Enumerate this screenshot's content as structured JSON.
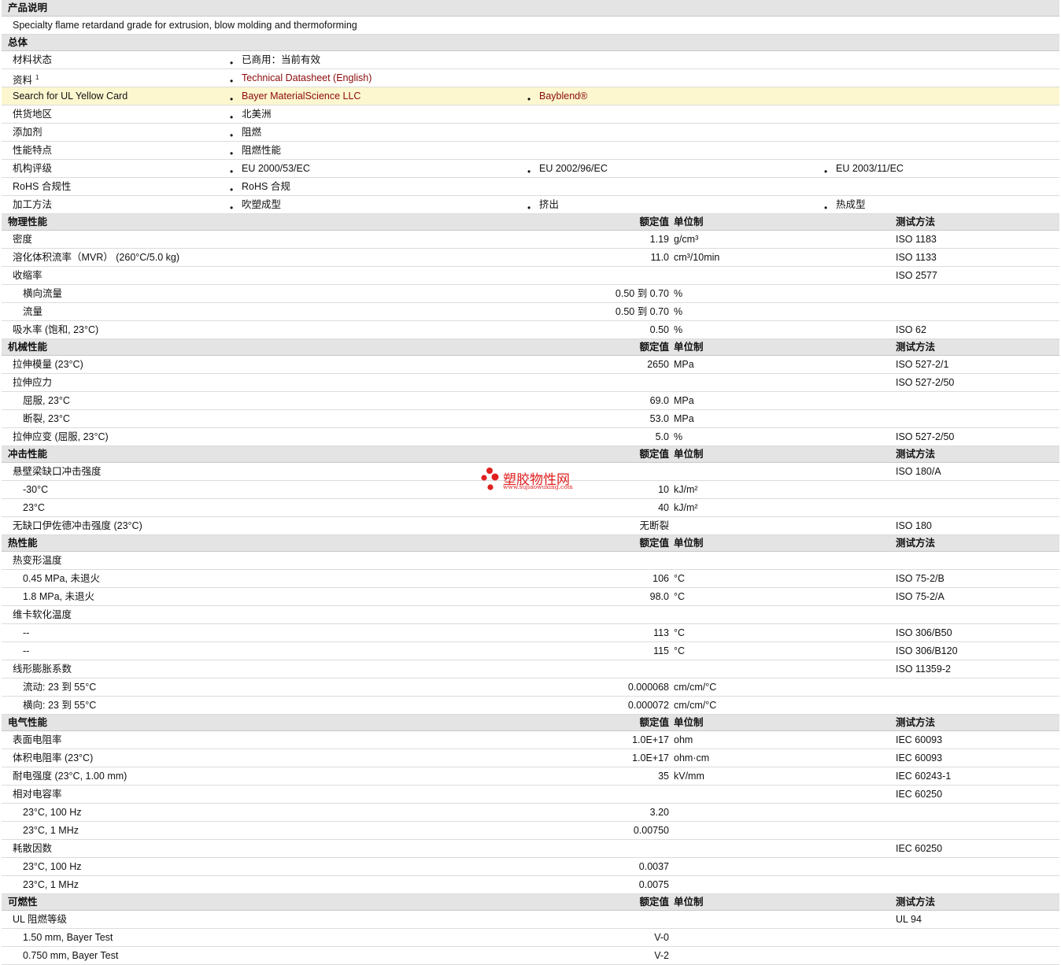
{
  "sections": {
    "description": {
      "title": "产品说明",
      "text": "Specialty flame retardand grade for extrusion, blow molding and thermoforming"
    },
    "general": {
      "title": "总体",
      "rows": [
        {
          "label": "材料状态",
          "items": [
            "已商用：当前有效"
          ]
        },
        {
          "label": "资料",
          "sup": "1",
          "items": [
            "Technical Datasheet (English)"
          ],
          "links": true
        },
        {
          "label": "Search for UL Yellow Card",
          "items": [
            "Bayer MaterialScience LLC",
            "Bayblend®"
          ],
          "links": true,
          "highlight": true
        },
        {
          "label": "供货地区",
          "items": [
            "北美洲"
          ]
        },
        {
          "label": "添加剂",
          "items": [
            "阻燃"
          ]
        },
        {
          "label": "性能特点",
          "items": [
            "阻燃性能"
          ]
        },
        {
          "label": "机构评级",
          "items": [
            "EU 2000/53/EC",
            "EU 2002/96/EC",
            "EU 2003/11/EC"
          ]
        },
        {
          "label": "RoHS 合规性",
          "items": [
            "RoHS 合规"
          ]
        },
        {
          "label": "加工方法",
          "items": [
            "吹塑成型",
            "挤出",
            "热成型"
          ]
        }
      ]
    },
    "columns": {
      "value": "额定值",
      "unit": "单位制",
      "test": "测试方法"
    },
    "tables": [
      {
        "title": "物理性能",
        "rows": [
          {
            "label": "密度",
            "value": "1.19",
            "unit": "g/cm³",
            "test": "ISO 1183"
          },
          {
            "label": "溶化体积流率（MVR）  (260°C/5.0 kg)",
            "value": "11.0",
            "unit": "cm³/10min",
            "test": "ISO 1133"
          },
          {
            "label": "收缩率",
            "value": "",
            "unit": "",
            "test": "ISO 2577"
          },
          {
            "label": "横向流量",
            "sub": true,
            "value": "0.50 到  0.70",
            "unit": "%",
            "test": ""
          },
          {
            "label": "流量",
            "sub": true,
            "value": "0.50 到  0.70",
            "unit": "%",
            "test": ""
          },
          {
            "label": "吸水率  (饱和, 23°C)",
            "value": "0.50",
            "unit": "%",
            "test": "ISO 62"
          }
        ]
      },
      {
        "title": "机械性能",
        "rows": [
          {
            "label": "拉伸模量  (23°C)",
            "value": "2650",
            "unit": "MPa",
            "test": "ISO 527-2/1"
          },
          {
            "label": "拉伸应力",
            "value": "",
            "unit": "",
            "test": "ISO 527-2/50"
          },
          {
            "label": "屈服, 23°C",
            "sub": true,
            "value": "69.0",
            "unit": "MPa",
            "test": ""
          },
          {
            "label": "断裂, 23°C",
            "sub": true,
            "value": "53.0",
            "unit": "MPa",
            "test": ""
          },
          {
            "label": "拉伸应变  (屈服, 23°C)",
            "value": "5.0",
            "unit": "%",
            "test": "ISO 527-2/50"
          }
        ]
      },
      {
        "title": "冲击性能",
        "rows": [
          {
            "label": "悬壁梁缺口冲击强度",
            "value": "",
            "unit": "",
            "test": "ISO 180/A"
          },
          {
            "label": "-30°C",
            "sub": true,
            "value": "10",
            "unit": "kJ/m²",
            "test": ""
          },
          {
            "label": "23°C",
            "sub": true,
            "value": "40",
            "unit": "kJ/m²",
            "test": ""
          },
          {
            "label": "无缺口伊佐德冲击强度  (23°C)",
            "value": "无断裂",
            "unit": "",
            "test": "ISO 180"
          }
        ]
      },
      {
        "title": "热性能",
        "rows": [
          {
            "label": "热变形温度",
            "value": "",
            "unit": "",
            "test": ""
          },
          {
            "label": "0.45 MPa, 未退火",
            "sub": true,
            "value": "106",
            "unit": "°C",
            "test": "ISO 75-2/B"
          },
          {
            "label": "1.8 MPa, 未退火",
            "sub": true,
            "value": "98.0",
            "unit": "°C",
            "test": "ISO 75-2/A"
          },
          {
            "label": "维卡软化温度",
            "value": "",
            "unit": "",
            "test": ""
          },
          {
            "label": "--",
            "sub": true,
            "value": "113",
            "unit": "°C",
            "test": "ISO 306/B50"
          },
          {
            "label": "--",
            "sub": true,
            "value": "115",
            "unit": "°C",
            "test": "ISO 306/B120"
          },
          {
            "label": "线形膨胀系数",
            "value": "",
            "unit": "",
            "test": "ISO 11359-2"
          },
          {
            "label": "流动: 23 到  55°C",
            "sub": true,
            "value": "0.000068",
            "unit": "cm/cm/°C",
            "test": ""
          },
          {
            "label": "横向: 23 到  55°C",
            "sub": true,
            "value": "0.000072",
            "unit": "cm/cm/°C",
            "test": ""
          }
        ]
      },
      {
        "title": "电气性能",
        "rows": [
          {
            "label": "表面电阻率",
            "value": "1.0E+17",
            "unit": "ohm",
            "test": "IEC 60093"
          },
          {
            "label": "体积电阻率  (23°C)",
            "value": "1.0E+17",
            "unit": "ohm·cm",
            "test": "IEC 60093"
          },
          {
            "label": "耐电强度  (23°C, 1.00 mm)",
            "value": "35",
            "unit": "kV/mm",
            "test": "IEC 60243-1"
          },
          {
            "label": "相对电容率",
            "value": "",
            "unit": "",
            "test": "IEC 60250"
          },
          {
            "label": "23°C, 100 Hz",
            "sub": true,
            "value": "3.20",
            "unit": "",
            "test": ""
          },
          {
            "label": "23°C, 1 MHz",
            "sub": true,
            "value": "0.00750",
            "unit": "",
            "test": ""
          },
          {
            "label": "耗散因数",
            "value": "",
            "unit": "",
            "test": "IEC 60250"
          },
          {
            "label": "23°C, 100 Hz",
            "sub": true,
            "value": "0.0037",
            "unit": "",
            "test": ""
          },
          {
            "label": "23°C, 1 MHz",
            "sub": true,
            "value": "0.0075",
            "unit": "",
            "test": ""
          }
        ]
      },
      {
        "title": "可燃性",
        "rows": [
          {
            "label": "UL 阻燃等级",
            "value": "",
            "unit": "",
            "test": "UL 94"
          },
          {
            "label": "1.50 mm, Bayer Test",
            "sub": true,
            "value": "V-0",
            "unit": "",
            "test": ""
          },
          {
            "label": "0.750 mm, Bayer Test",
            "sub": true,
            "value": "V-2",
            "unit": "",
            "test": ""
          }
        ]
      }
    ]
  },
  "watermark": {
    "text": "塑胶物性网",
    "url": "www.sujiaowuxing.com",
    "color": "#e02020"
  },
  "colors": {
    "header_bg": "#e4e4e4",
    "link": "#8b0a0a",
    "highlight_bg": "#fdf7d0"
  }
}
